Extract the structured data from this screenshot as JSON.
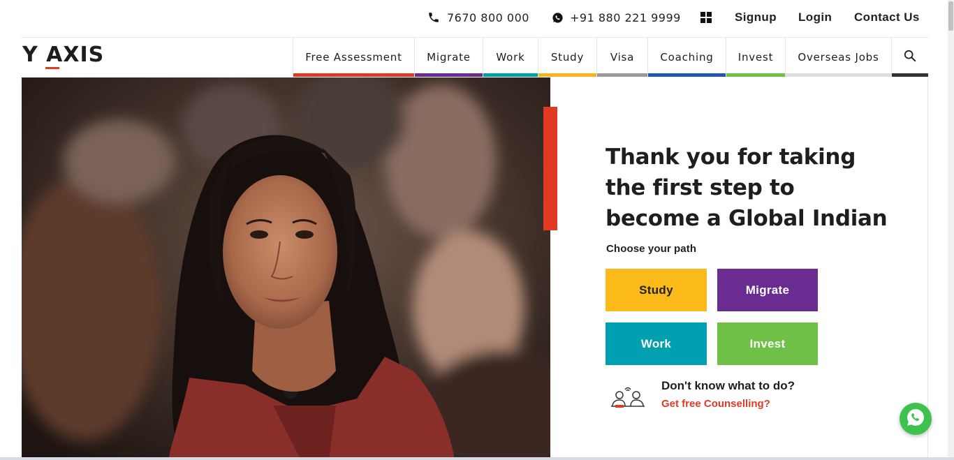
{
  "topbar": {
    "phone": "7670 800 000",
    "whatsapp": "+91 880 221 9999",
    "signup": "Signup",
    "login": "Login",
    "contact": "Contact Us",
    "icons": [
      "phone-icon",
      "whatsapp-icon",
      "grid-icon"
    ]
  },
  "logo": {
    "text": "Y AXIS",
    "accent": "#e03a25"
  },
  "nav": {
    "items": [
      {
        "label": "Free Assessment",
        "color": "#e03a25"
      },
      {
        "label": "Migrate",
        "color": "#6a2c91"
      },
      {
        "label": "Work",
        "color": "#00a0a8"
      },
      {
        "label": "Study",
        "color": "#f5b51b"
      },
      {
        "label": "Visa",
        "color": "#9a9a9a"
      },
      {
        "label": "Coaching",
        "color": "#1f5aa6"
      },
      {
        "label": "Invest",
        "color": "#6ec046"
      },
      {
        "label": "Overseas Jobs",
        "color": "#dddddd"
      }
    ],
    "search_icon": "search-icon",
    "search_color": "#333333"
  },
  "hero": {
    "headline_lines": [
      "Thank you for taking",
      "the first step to",
      "become a Global Indian"
    ],
    "subhead": "Choose your path",
    "accent_color": "#e03a25",
    "paths": [
      {
        "label": "Study",
        "bg": "#fbb91a",
        "fg": "#222222"
      },
      {
        "label": "Migrate",
        "bg": "#6a2c91",
        "fg": "#ffffff"
      },
      {
        "label": "Work",
        "bg": "#00a0b0",
        "fg": "#ffffff"
      },
      {
        "label": "Invest",
        "bg": "#6ec046",
        "fg": "#ffffff"
      }
    ],
    "counsel_question": "Don't know what to do?",
    "counsel_link": "Get free Counselling?"
  },
  "floating": {
    "whatsapp_icon": "whatsapp-icon",
    "color": "#3fc24d"
  }
}
